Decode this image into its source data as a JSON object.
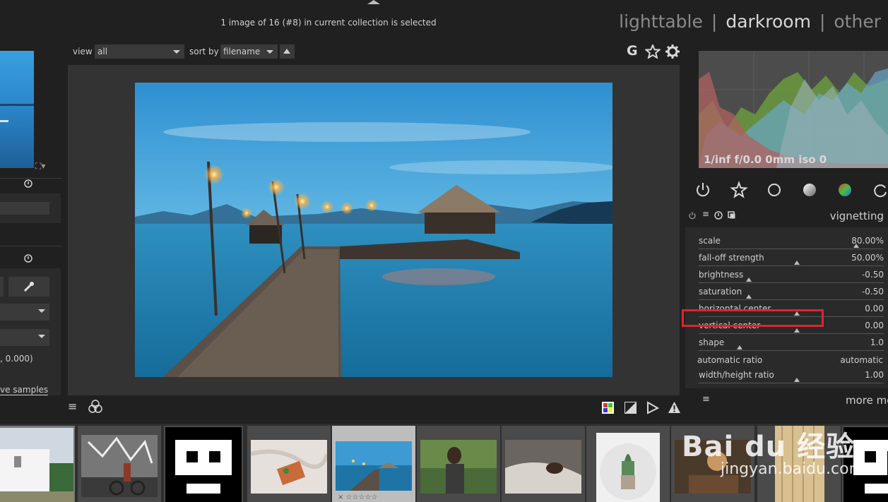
{
  "header": {
    "status": "1 image of 16 (#8) in current collection is selected",
    "views": [
      "lighttable",
      "darkroom",
      "other"
    ],
    "separators": [
      "|",
      "|"
    ],
    "active_view": "darkroom"
  },
  "toolbar": {
    "view_label": "view",
    "view_value": "all",
    "sort_label": "sort by",
    "sort_value": "filename",
    "sort_direction_icon": "triangle-up-icon",
    "right_icons": [
      "grouping-G-icon",
      "star-overlay-icon",
      "gear-icon"
    ],
    "grouping_glyph": "G"
  },
  "left_panel": {
    "coords_text": ", 0.000)",
    "samples_link": "ve samples"
  },
  "histogram": {
    "exif_caption": "1/inf f/0.0 0mm iso 0"
  },
  "module_group_icons": [
    "power-icon",
    "star-icon",
    "circle-icon",
    "shaded-circle-icon",
    "color-circle-icon",
    "retouch-icon"
  ],
  "module": {
    "header_icons": [
      "power-icon",
      "presets-icon",
      "reset-icon",
      "instances-icon"
    ],
    "title": "vignetting",
    "params": [
      {
        "label": "scale",
        "value": "80.00%",
        "marker": 0.85
      },
      {
        "label": "fall-off strength",
        "value": "50.00%",
        "marker": 0.53
      },
      {
        "label": "brightness",
        "value": "-0.50",
        "marker": 0.27
      },
      {
        "label": "saturation",
        "value": "-0.50",
        "marker": 0.27
      },
      {
        "label": "horizontal center",
        "value": "0.00",
        "marker": 0.53
      },
      {
        "label": "vertical center",
        "value": "0.00",
        "marker": 0.53
      },
      {
        "label": "shape",
        "value": "1.0",
        "marker": 0.22
      }
    ],
    "auto_ratio_label": "automatic ratio",
    "auto_ratio_value": "automatic",
    "wh_ratio_label": "width/height ratio",
    "wh_ratio_value": "1.00",
    "wh_ratio_marker": 0.53,
    "more_modules": "more mo"
  },
  "bottom_icons": {
    "left": [
      "menu-icon",
      "color-picker-circles-icon"
    ],
    "right": [
      "color-grid-icon",
      "exposure-icon",
      "focus-peaking-icon",
      "warning-icon"
    ]
  },
  "watermark": {
    "brand": "Bai du 经验",
    "url": "jingyan.baidu.com"
  },
  "colors": {
    "highlight": "#e0242b",
    "background": "#202020"
  }
}
